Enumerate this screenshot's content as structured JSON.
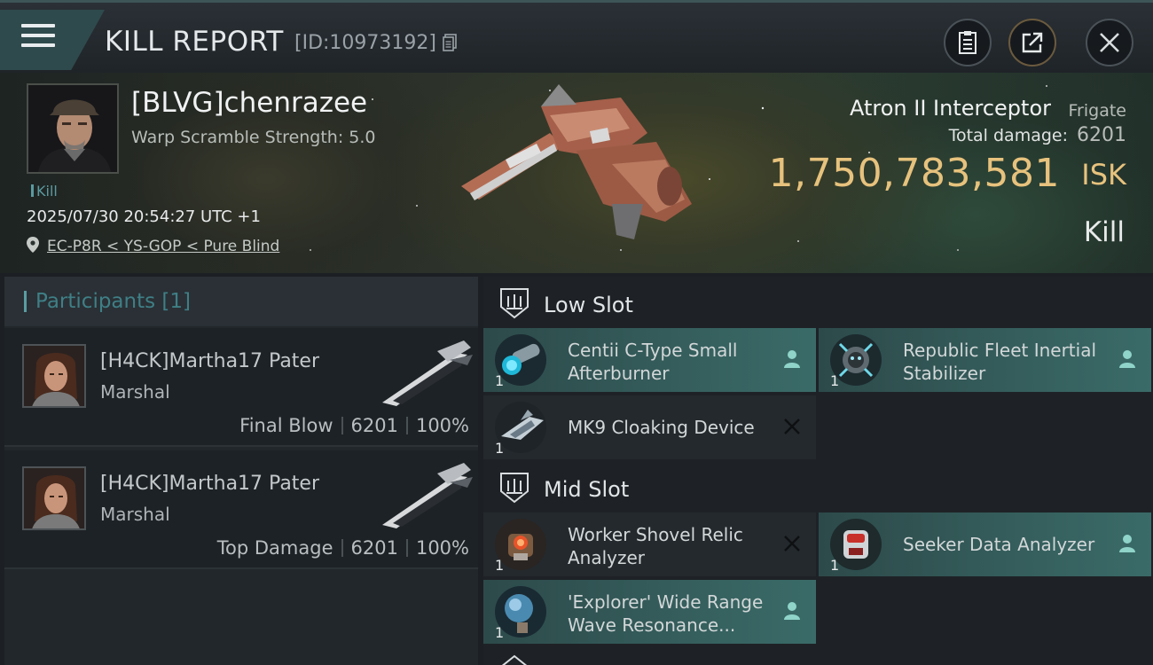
{
  "header": {
    "title": "KILL REPORT",
    "report_id": "[ID:10973192]"
  },
  "victim": {
    "name": "[BLVG]chenrazee",
    "subtitle": "Warp Scramble Strength: 5.0",
    "tag": "Kill",
    "datetime": "2025/07/30 20:54:27 UTC +1",
    "location": "EC-P8R < YS-GOP < Pure Blind"
  },
  "ship": {
    "name": "Atron II Interceptor",
    "class": "Frigate",
    "damage_label": "Total damage:",
    "damage_value": "6201",
    "isk_value": "1,750,783,581",
    "isk_unit": "ISK",
    "result": "Kill"
  },
  "participants": {
    "title": "Participants [1]",
    "rows": [
      {
        "name": "[H4CK]Martha17 Pater",
        "corp": "Marshal",
        "label": "Final Blow",
        "damage": "6201",
        "percent": "100%"
      },
      {
        "name": "[H4CK]Martha17 Pater",
        "corp": "Marshal",
        "label": "Top Damage",
        "damage": "6201",
        "percent": "100%"
      }
    ]
  },
  "slots": {
    "low": {
      "title": "Low Slot",
      "items": [
        {
          "name": "Centii C-Type Small Afterburner",
          "qty": "1",
          "status": "dropped"
        },
        {
          "name": "Republic Fleet Inertial Stabilizer",
          "qty": "1",
          "status": "dropped"
        },
        {
          "name": "MK9 Cloaking Device",
          "qty": "1",
          "status": "destroyed"
        }
      ]
    },
    "mid": {
      "title": "Mid Slot",
      "items": [
        {
          "name": "Worker Shovel Relic Analyzer",
          "qty": "1",
          "status": "destroyed"
        },
        {
          "name": "Seeker Data Analyzer",
          "qty": "1",
          "status": "dropped"
        },
        {
          "name": "'Explorer' Wide Range Wave Resonance...",
          "qty": "1",
          "status": "dropped"
        }
      ]
    }
  },
  "colors": {
    "isk": "#e7c27d",
    "teal_row": "#3a6b68",
    "accent": "#5a9ea3"
  }
}
